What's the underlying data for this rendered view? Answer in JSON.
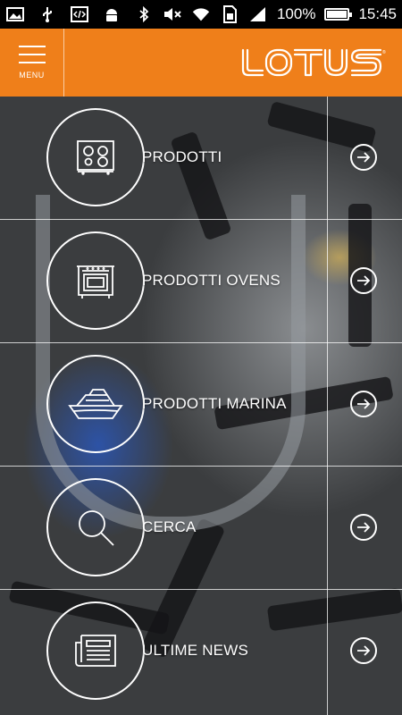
{
  "status_bar": {
    "left_icons": [
      "image-icon",
      "usb-icon",
      "code-icon",
      "android-icon"
    ],
    "right_icons": [
      "bluetooth-icon",
      "mute-icon",
      "wifi-icon",
      "sim-icon",
      "signal-icon"
    ],
    "battery_percent_text": "100%",
    "battery_level": 1.0,
    "time": "15:45"
  },
  "header": {
    "menu_label": "MENU",
    "brand": "LOTUS",
    "brand_color": "#ef7f1a"
  },
  "menu_items": [
    {
      "label": "PRODOTTI",
      "icon": "cooktop-icon"
    },
    {
      "label": "PRODOTTI OVENS",
      "icon": "oven-icon"
    },
    {
      "label": "PRODOTTI MARINA",
      "icon": "boat-icon"
    },
    {
      "label": "CERCA",
      "icon": "search-icon"
    },
    {
      "label": "ULTIME NEWS",
      "icon": "news-icon"
    }
  ]
}
